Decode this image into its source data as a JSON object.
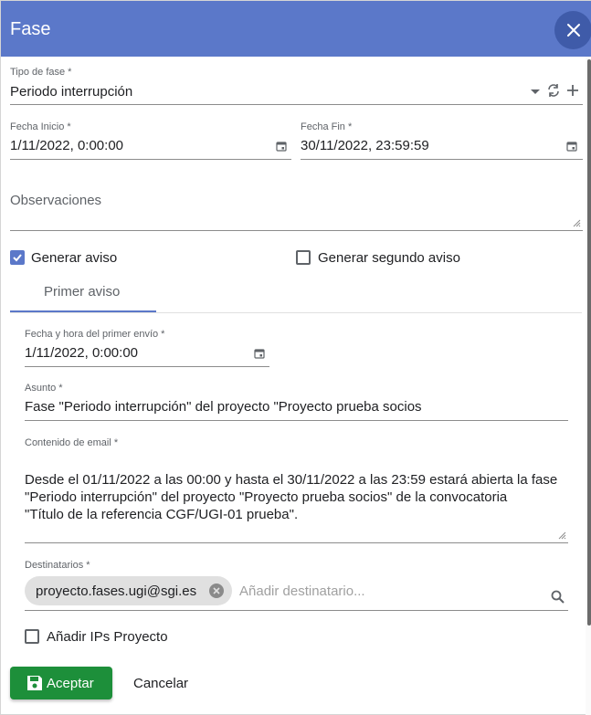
{
  "dialog": {
    "title": "Fase"
  },
  "tipo_fase": {
    "label": "Tipo de fase *",
    "value": "Periodo interrupción"
  },
  "fecha_inicio": {
    "label": "Fecha Inicio *",
    "value": "1/11/2022, 0:00:00"
  },
  "fecha_fin": {
    "label": "Fecha Fin *",
    "value": "30/11/2022, 23:59:59"
  },
  "observaciones": {
    "label": "Observaciones",
    "value": ""
  },
  "generar_aviso": {
    "label": "Generar aviso",
    "checked": true
  },
  "generar_segundo_aviso": {
    "label": "Generar segundo aviso",
    "checked": false
  },
  "tabs": [
    {
      "label": "Primer aviso",
      "active": true
    }
  ],
  "primer_envio": {
    "label": "Fecha y hora del primer envío *",
    "value": "1/11/2022, 0:00:00"
  },
  "asunto": {
    "label": "Asunto *",
    "value": "Fase \"Periodo interrupción\" del proyecto \"Proyecto prueba socios"
  },
  "contenido": {
    "label": "Contenido de email *",
    "value": "Desde el 01/11/2022 a las 00:00 y hasta el 30/11/2022 a las 23:59 estará abierta la fase\n\"Periodo interrupción\" del proyecto \"Proyecto prueba socios\" de la convocatoria\n\"Título de la referencia CGF/UGI-01 prueba\"."
  },
  "destinatarios": {
    "label": "Destinatarios *",
    "chips": [
      "proyecto.fases.ugi@sgi.es"
    ],
    "placeholder": "Añadir destinatario..."
  },
  "anadir_ips": {
    "label": "Añadir IPs Proyecto",
    "checked": false
  },
  "buttons": {
    "accept": "Aceptar",
    "cancel": "Cancelar"
  },
  "colors": {
    "header": "#5b78c9",
    "accept": "#1d8f3a",
    "checkbox": "#5b78c9"
  },
  "icons": [
    "close-icon",
    "dropdown-arrow-icon",
    "refresh-icon",
    "add-icon",
    "calendar-icon",
    "search-icon",
    "save-icon",
    "chip-remove-icon"
  ]
}
